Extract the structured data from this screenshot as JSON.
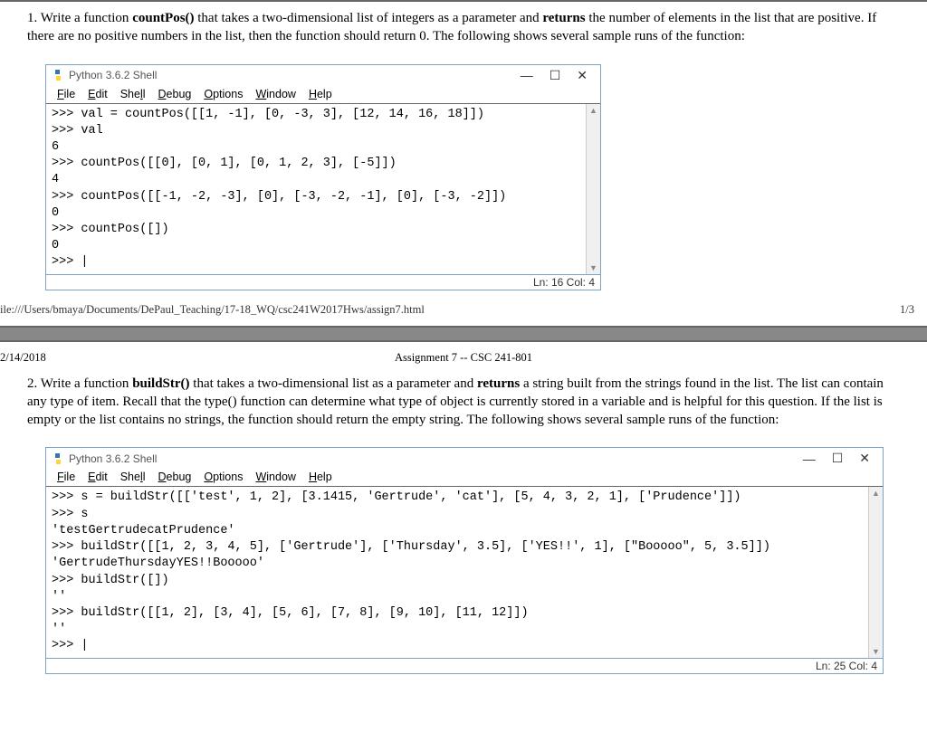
{
  "question1": {
    "number": "1. ",
    "text_before_fn": "Write a function ",
    "fn_name": "countPos()",
    "text_mid": " that takes a two-dimensional list of integers as a parameter and ",
    "returns": "returns",
    "text_after": " the number of elements in the list that are positive. If there are no positive numbers in the list, then the function should return 0. The following shows several sample runs of the function:"
  },
  "shell1": {
    "title": "Python 3.6.2 Shell",
    "menu": [
      "File",
      "Edit",
      "Shell",
      "Debug",
      "Options",
      "Window",
      "Help"
    ],
    "content": ">>> val = countPos([[1, -1], [0, -3, 3], [12, 14, 16, 18]])\n>>> val\n6\n>>> countPos([[0], [0, 1], [0, 1, 2, 3], [-5]])\n4\n>>> countPos([[-1, -2, -3], [0], [-3, -2, -1], [0], [-3, -2]])\n0\n>>> countPos([])\n0\n>>> |",
    "status": "Ln: 16  Col: 4"
  },
  "url_footer": {
    "url": "ile:///Users/bmaya/Documents/DePaul_Teaching/17-18_WQ/csc241W2017Hws/assign7.html",
    "page": "1/3"
  },
  "date_header": {
    "date": "2/14/2018",
    "title": "Assignment 7 -- CSC 241-801"
  },
  "question2": {
    "number": "2. ",
    "text_before_fn": "Write a function ",
    "fn_name": "buildStr()",
    "text_mid": " that takes a two-dimensional list as a parameter and ",
    "returns": "returns",
    "text_after": " a string built from the strings found in the list. The list can contain any type of item. Recall that the type() function can determine what type of object is currently stored in a variable and is helpful for this question. If the list is empty or the list contains no strings, the function should return the empty string. The following shows several sample runs of the function:"
  },
  "shell2": {
    "title": "Python 3.6.2 Shell",
    "menu": [
      "File",
      "Edit",
      "Shell",
      "Debug",
      "Options",
      "Window",
      "Help"
    ],
    "content": ">>> s = buildStr([['test', 1, 2], [3.1415, 'Gertrude', 'cat'], [5, 4, 3, 2, 1], ['Prudence']])\n>>> s\n'testGertrudecatPrudence'\n>>> buildStr([[1, 2, 3, 4, 5], ['Gertrude'], ['Thursday', 3.5], ['YES!!', 1], [\"Booooo\", 5, 3.5]])\n'GertrudeThursdayYES!!Booooo'\n>>> buildStr([])\n''\n>>> buildStr([[1, 2], [3, 4], [5, 6], [7, 8], [9, 10], [11, 12]])\n''\n>>> |",
    "status": "Ln: 25  Col: 4"
  },
  "win_controls": {
    "min": "—",
    "max": "☐",
    "close": "✕"
  }
}
